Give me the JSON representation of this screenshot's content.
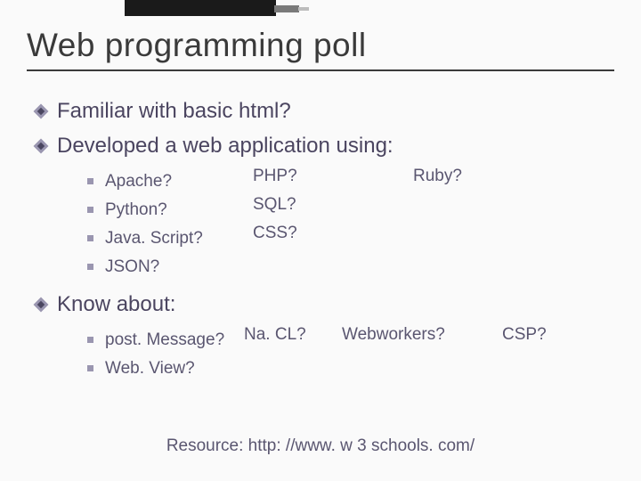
{
  "title": "Web programming poll",
  "bullets": {
    "b1": "Familiar with basic html?",
    "b2": "Developed a web application using:",
    "b3": "Know about:"
  },
  "dev": {
    "colA": [
      "Apache?",
      "Python?",
      "Java. Script?",
      "JSON?"
    ],
    "colB": [
      "PHP?",
      "SQL?",
      "CSS?"
    ],
    "colC": [
      "Ruby?"
    ]
  },
  "know": {
    "colA": [
      "post. Message?",
      "Web. View?"
    ],
    "colB": [
      "Na. CL?"
    ],
    "colC": [
      "Webworkers?"
    ],
    "colD": [
      "CSP?"
    ]
  },
  "resource": "Resource:  http: //www. w 3 schools. com/"
}
